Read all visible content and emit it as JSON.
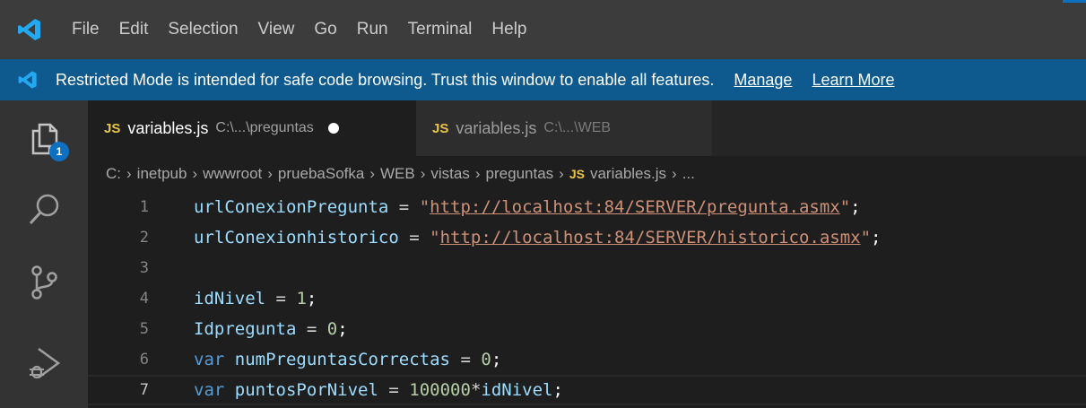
{
  "titlebar": {
    "menu": [
      "File",
      "Edit",
      "Selection",
      "View",
      "Go",
      "Run",
      "Terminal",
      "Help"
    ]
  },
  "banner": {
    "text": "Restricted Mode is intended for safe code browsing. Trust this window to enable all features.",
    "manage": "Manage",
    "learn_more": "Learn More"
  },
  "activity": {
    "explorer_badge": "1",
    "icons": [
      "explorer-icon",
      "search-icon",
      "source-control-icon",
      "run-debug-icon"
    ]
  },
  "tabs": [
    {
      "lang": "JS",
      "name": "variables.js",
      "path": "C:\\...\\preguntas",
      "dirty": true,
      "active": true
    },
    {
      "lang": "JS",
      "name": "variables.js",
      "path": "C:\\...\\WEB",
      "dirty": false,
      "active": false
    }
  ],
  "breadcrumb": {
    "parts": [
      "C:",
      "inetpub",
      "wwwroot",
      "pruebaSofka",
      "WEB",
      "vistas",
      "preguntas"
    ],
    "file_lang": "JS",
    "file": "variables.js",
    "tail": "..."
  },
  "editor": {
    "current_line": 7,
    "lines": [
      {
        "n": "1",
        "text": "urlConexionPregunta = \"http://localhost:84/SERVER/pregunta.asmx\";"
      },
      {
        "n": "2",
        "text": "urlConexionhistorico = \"http://localhost:84/SERVER/historico.asmx\";"
      },
      {
        "n": "3",
        "text": ""
      },
      {
        "n": "4",
        "text": "idNivel = 1;"
      },
      {
        "n": "5",
        "text": "Idpregunta = 0;"
      },
      {
        "n": "6",
        "text": "var numPreguntasCorrectas = 0;"
      },
      {
        "n": "7",
        "text": "var puntosPorNivel = 100000*idNivel;"
      }
    ]
  },
  "colors": {
    "titlebar": "#3c3c3c",
    "banner": "#0e5a8e",
    "activitybar": "#333333",
    "editor_bg": "#1e1e1e",
    "accent": "#0e70c0"
  }
}
